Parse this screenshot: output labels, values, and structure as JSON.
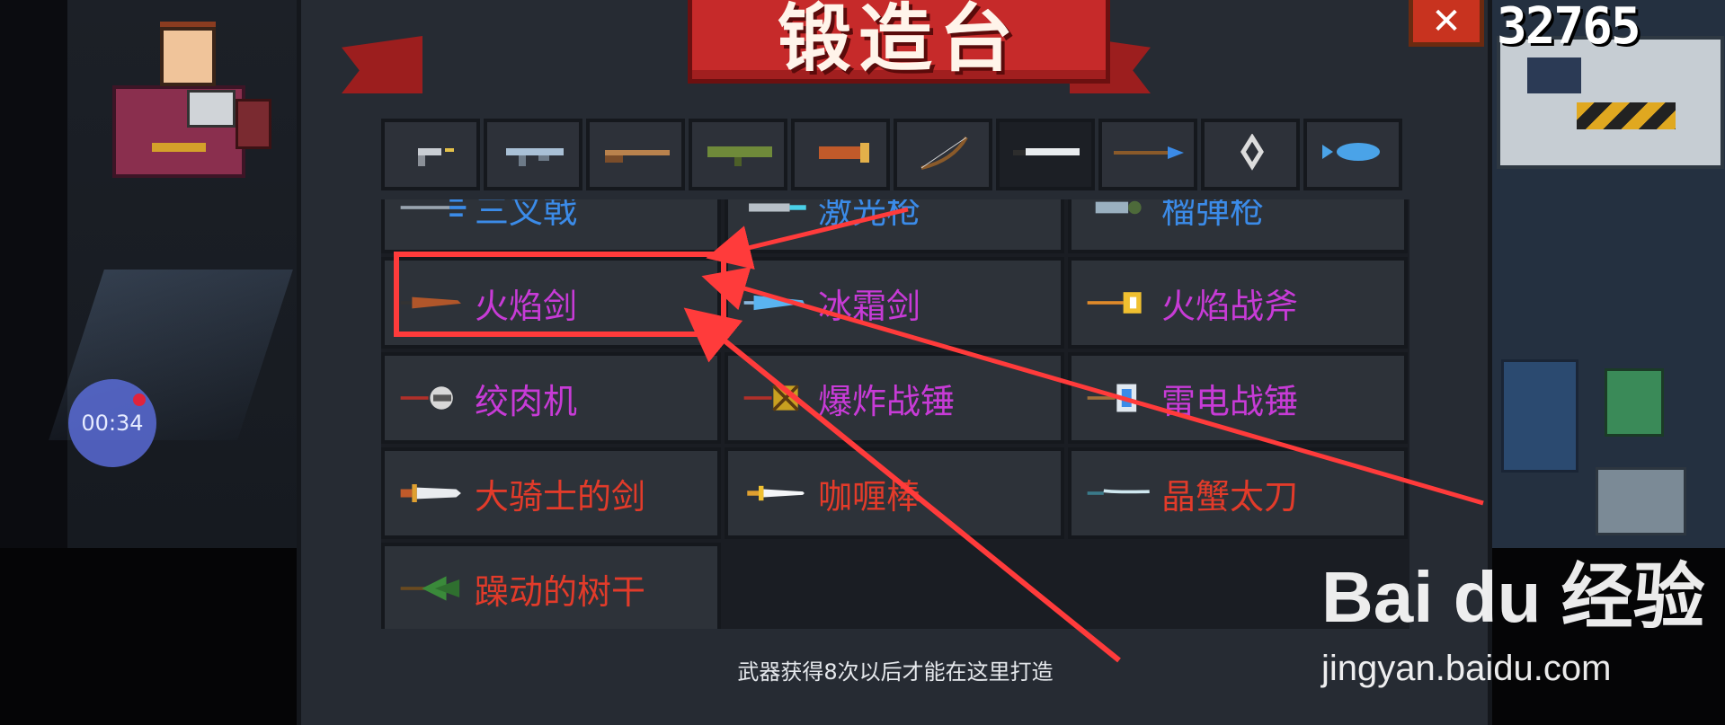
{
  "header": {
    "title": "锻造台",
    "close_label": "✕"
  },
  "score": "32765",
  "timer": "00:34",
  "categories": [
    {
      "icon": "pistol-icon",
      "active": false
    },
    {
      "icon": "rifle-icon",
      "active": false
    },
    {
      "icon": "shotgun-icon",
      "active": false
    },
    {
      "icon": "launcher-icon",
      "active": false
    },
    {
      "icon": "cannon-icon",
      "active": false
    },
    {
      "icon": "bow-icon",
      "active": false
    },
    {
      "icon": "sword-icon",
      "active": true
    },
    {
      "icon": "spear-icon",
      "active": false
    },
    {
      "icon": "shuriken-icon",
      "active": false
    },
    {
      "icon": "fish-icon",
      "active": false
    }
  ],
  "weapons": [
    {
      "name": "三叉戟",
      "color": "blue",
      "icon": "trident-icon"
    },
    {
      "name": "激光枪",
      "color": "blue",
      "icon": "laser-icon"
    },
    {
      "name": "榴弹枪",
      "color": "blue",
      "icon": "grenade-icon"
    },
    {
      "name": "火焰剑",
      "color": "purple",
      "icon": "flame-sword-icon"
    },
    {
      "name": "冰霜剑",
      "color": "purple",
      "icon": "frost-sword-icon"
    },
    {
      "name": "火焰战斧",
      "color": "purple",
      "icon": "flame-axe-icon"
    },
    {
      "name": "绞肉机",
      "color": "purple",
      "icon": "grinder-icon"
    },
    {
      "name": "爆炸战锤",
      "color": "purple",
      "icon": "explosive-hammer-icon"
    },
    {
      "name": "雷电战锤",
      "color": "purple",
      "icon": "thunder-hammer-icon"
    },
    {
      "name": "大骑士的剑",
      "color": "red",
      "icon": "knight-sword-icon"
    },
    {
      "name": "咖喱棒",
      "color": "red",
      "icon": "excalibur-icon"
    },
    {
      "name": "晶蟹太刀",
      "color": "red",
      "icon": "crab-katana-icon"
    },
    {
      "name": "躁动的树干",
      "color": "red",
      "icon": "tree-trunk-icon"
    }
  ],
  "hint": "武器获得8次以后才能在这里打造",
  "watermark": {
    "logo": "Bai du 经验",
    "url": "jingyan.baidu.com"
  },
  "colors": {
    "blue": "#3b8be8",
    "purple": "#c73bd6",
    "red": "#e23b2a",
    "annotation": "#ff3b3b"
  }
}
